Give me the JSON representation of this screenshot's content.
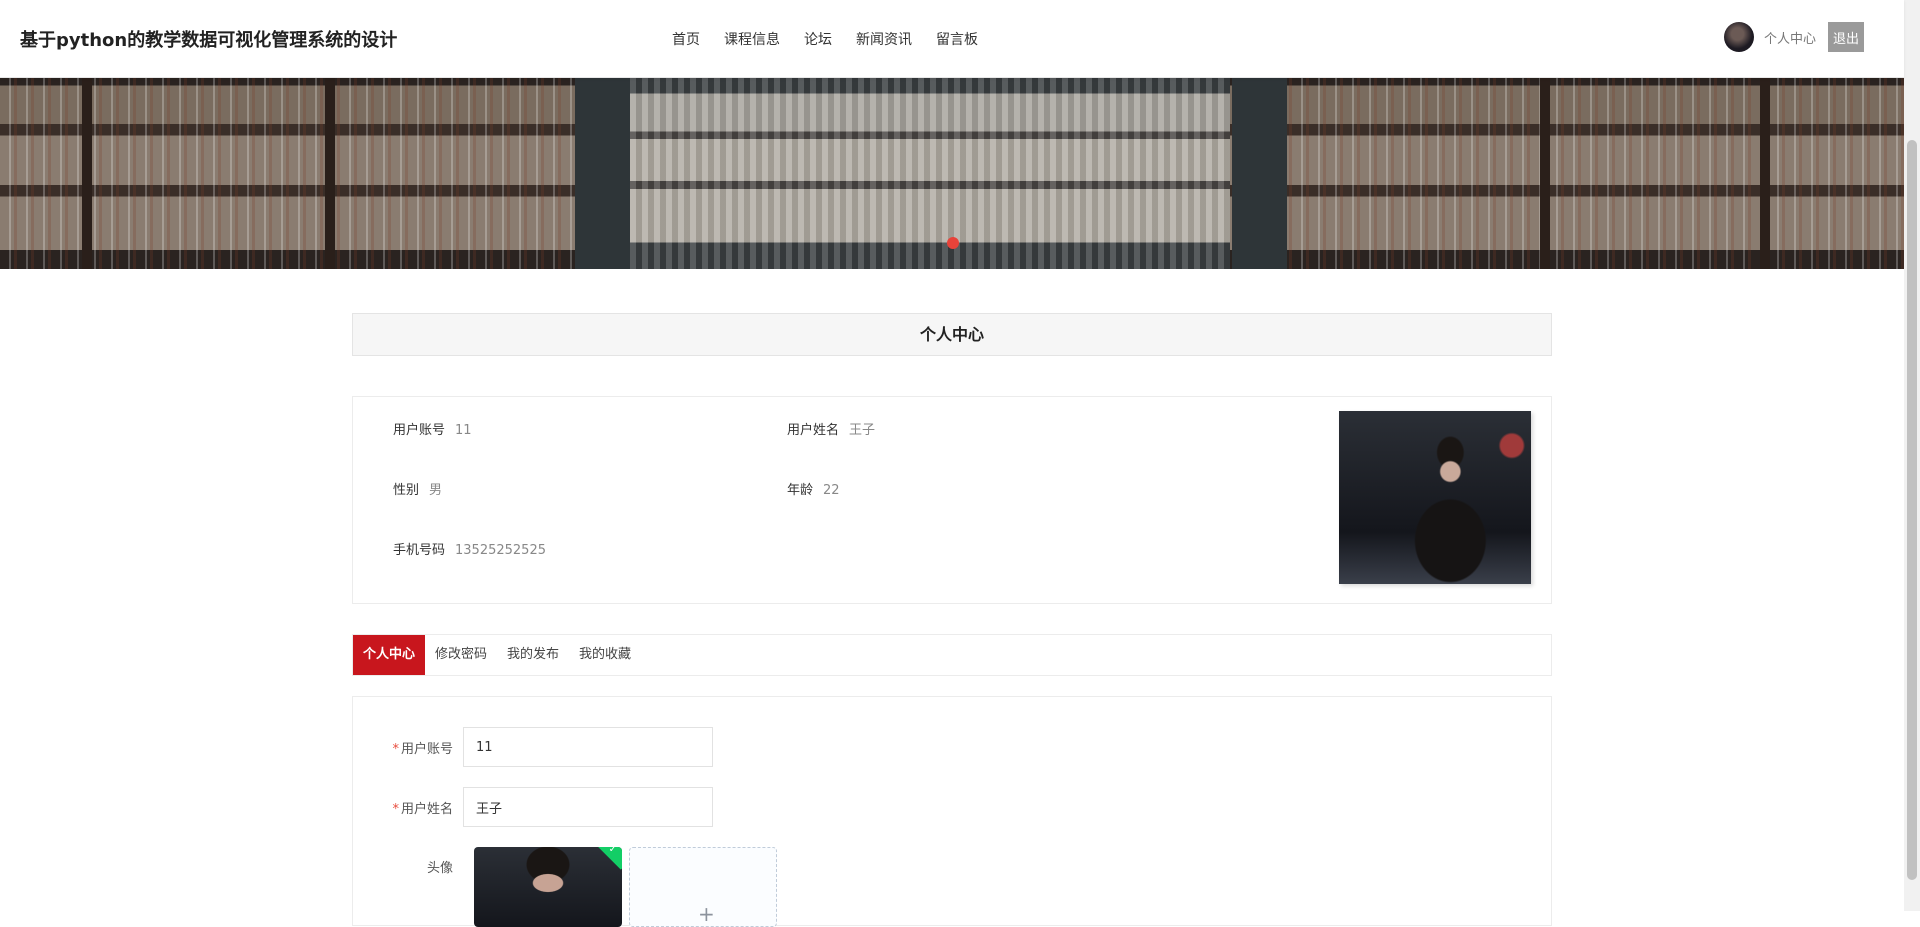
{
  "header": {
    "site_title": "基于python的教学数据可视化管理系统的设计",
    "nav": [
      "首页",
      "课程信息",
      "论坛",
      "新闻资讯",
      "留言板"
    ],
    "user_center": "个人中心",
    "logout": "退出"
  },
  "section": {
    "title": "个人中心"
  },
  "profile": {
    "account_label": "用户账号",
    "account_value": "11",
    "name_label": "用户姓名",
    "name_value": "王子",
    "gender_label": "性别",
    "gender_value": "男",
    "age_label": "年龄",
    "age_value": "22",
    "phone_label": "手机号码",
    "phone_value": "13525252525"
  },
  "tabs": [
    "个人中心",
    "修改密码",
    "我的发布",
    "我的收藏"
  ],
  "form": {
    "required_mark": "*",
    "account_label": "用户账号",
    "account_value": "11",
    "name_label": "用户姓名",
    "name_value": "王子",
    "avatar_label": "头像",
    "upload_add_icon": "+",
    "upload_check_icon": "✓"
  },
  "colors": {
    "accent": "#c8161d",
    "banner_dot": "#e8433a",
    "logout_bg": "#9a9a9a"
  }
}
